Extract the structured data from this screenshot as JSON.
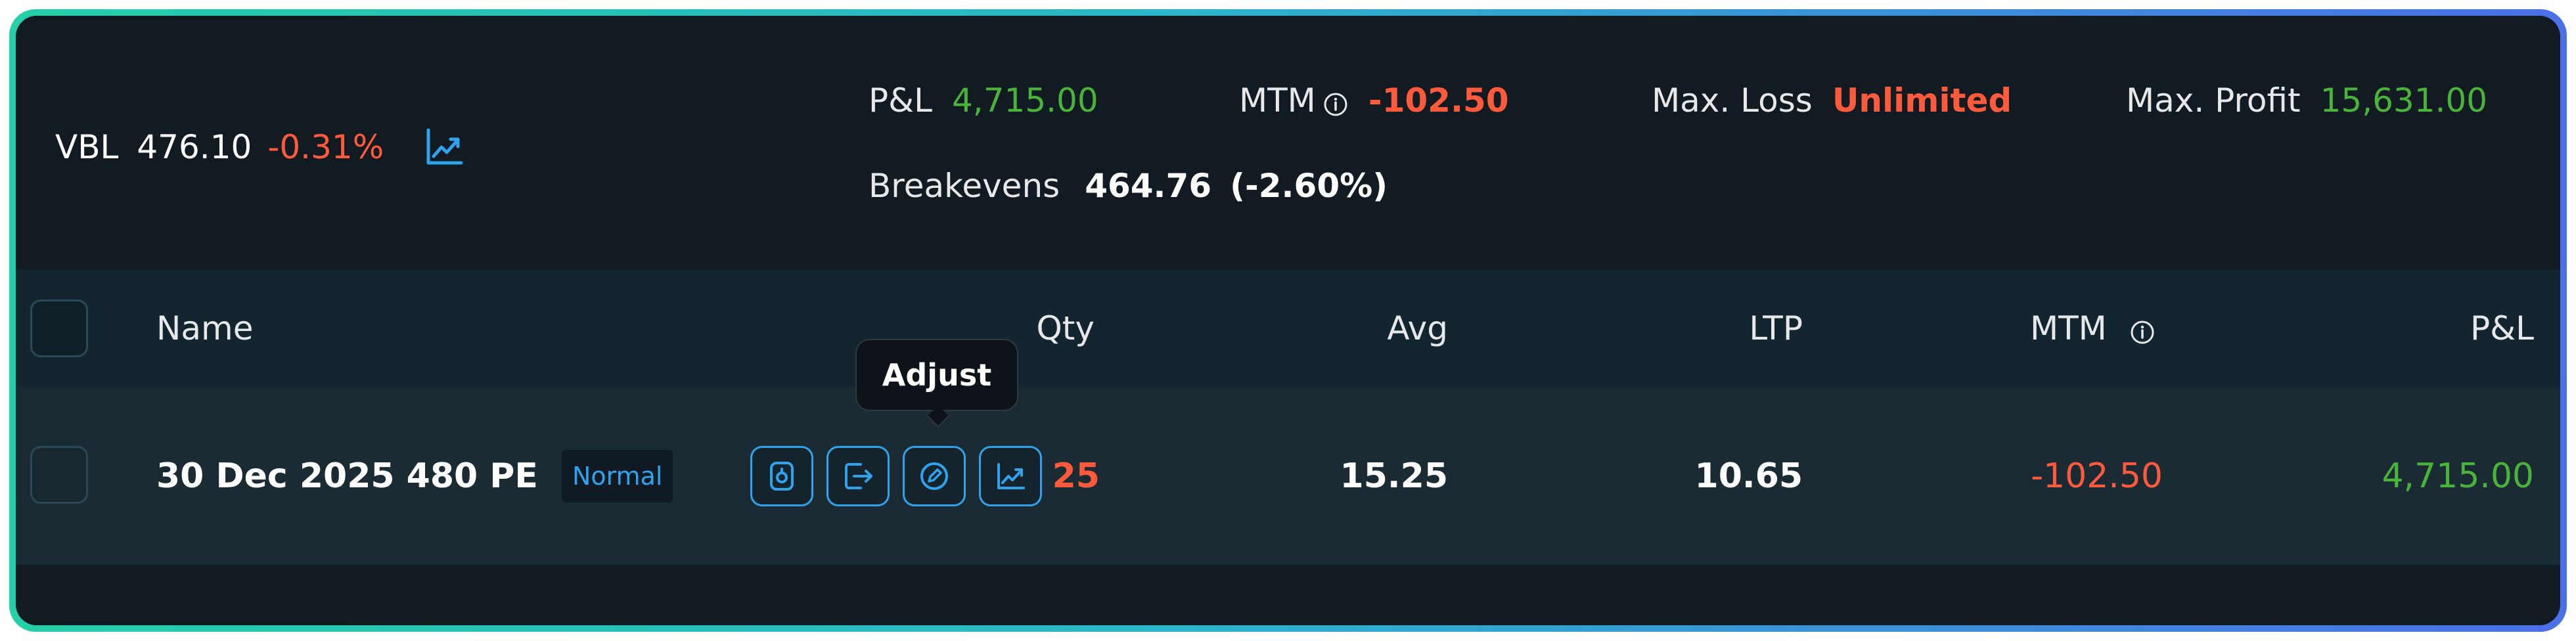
{
  "summary": {
    "symbol": "VBL",
    "price": "476.10",
    "change": "-0.31%",
    "pnl_label": "P&L",
    "pnl_value": "4,715.00",
    "mtm_label": "MTM",
    "mtm_value": "-102.50",
    "max_loss_label": "Max. Loss",
    "max_loss_value": "Unlimited",
    "max_profit_label": "Max. Profit",
    "max_profit_value": "15,631.00",
    "breakevens_label": "Breakevens",
    "breakevens_value": "464.76",
    "breakevens_pct": "(-2.60%)"
  },
  "table": {
    "headers": {
      "name": "Name",
      "qty": "Qty",
      "avg": "Avg",
      "ltp": "LTP",
      "mtm": "MTM",
      "pnl": "P&L"
    },
    "rows": [
      {
        "name": "30 Dec 2025 480 PE",
        "tag": "Normal",
        "qty": "25",
        "avg": "15.25",
        "ltp": "10.65",
        "mtm": "-102.50",
        "pnl": "4,715.00"
      }
    ]
  },
  "tooltip": {
    "text": "Adjust"
  },
  "icons": {
    "symbol_chart": "chart-trend-icon",
    "mtm_info": "info-icon",
    "actions": [
      "add-order-icon",
      "exit-icon",
      "adjust-edit-icon",
      "chart-trend-icon"
    ]
  },
  "colors": {
    "accent_blue": "#2ea3ee",
    "profit_green": "#49b43a",
    "loss_red": "#ff5a3c",
    "background": "#121a22"
  }
}
